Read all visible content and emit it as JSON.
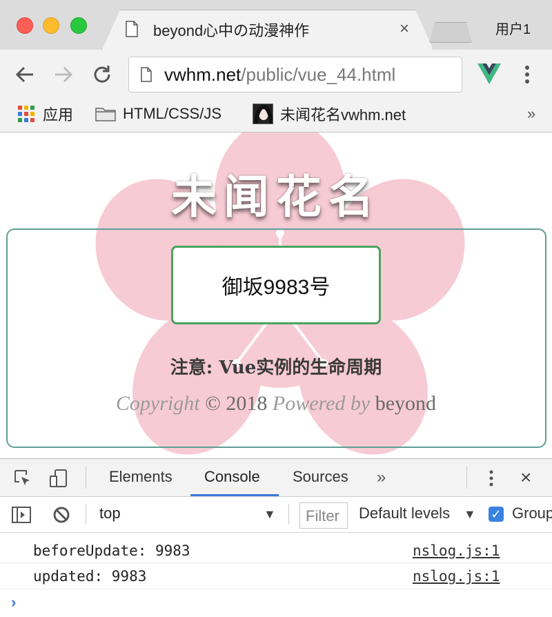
{
  "browser": {
    "tab_title": "beyond心中の动漫神作",
    "tab_close": "×",
    "user": "用户1",
    "address_host": "vwhm.net",
    "address_path": "/public/vue_44.html",
    "bookmarks": [
      {
        "label": "应用",
        "icon": "apps-grid-icon"
      },
      {
        "label": "HTML/CSS/JS",
        "icon": "folder-icon"
      },
      {
        "label": "未闻花名vwhm.net",
        "icon": "site-avatar-icon"
      }
    ],
    "bookmarks_more": "»"
  },
  "page": {
    "hero_title": "未闻花名",
    "name_box": "御坂9983号",
    "note": "注意: Vue实例的生命周期",
    "copyright_prefix": "Copyright © 2018",
    "copyright_powered": "Powered by",
    "copyright_author": "beyond",
    "colors": {
      "panel_border": "#5f9e92",
      "box_border": "#4aa35c",
      "flower": "#f7c6d0"
    }
  },
  "devtools": {
    "tabs": [
      "Elements",
      "Console",
      "Sources"
    ],
    "active_tab": "Console",
    "more": "»",
    "close": "×",
    "context": "top",
    "filter_placeholder": "Filter",
    "levels": "Default levels",
    "group_label": "Group similar",
    "logs": [
      {
        "message": "beforeUpdate: 9983",
        "source": "nslog.js:1"
      },
      {
        "message": "updated: 9983",
        "source": "nslog.js:1"
      }
    ],
    "prompt": "›"
  }
}
